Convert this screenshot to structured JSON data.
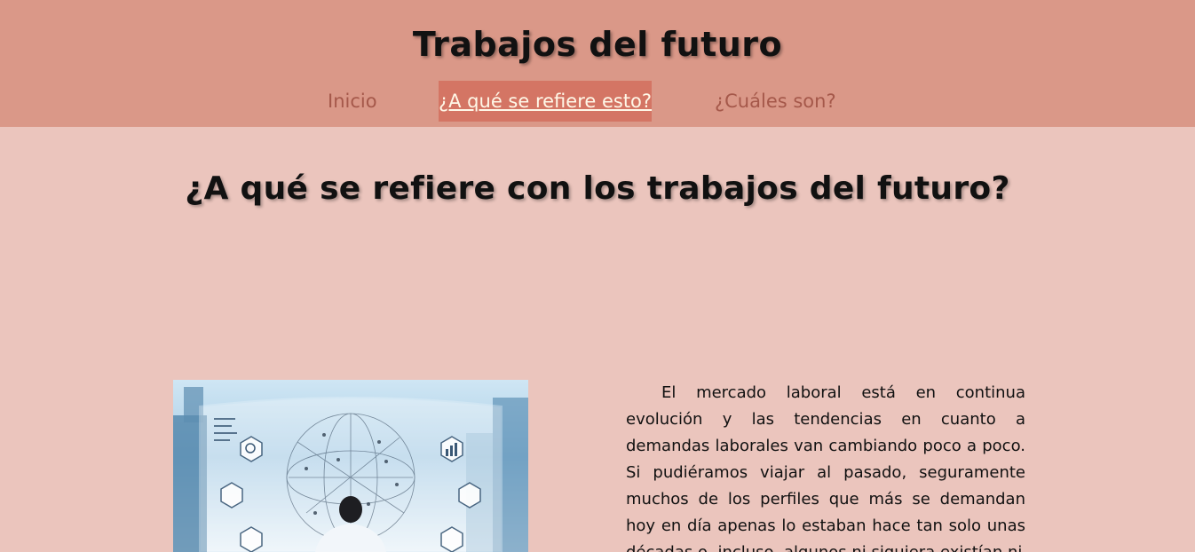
{
  "header": {
    "site_title": "Trabajos del futuro",
    "nav": [
      {
        "label": "Inicio",
        "active": false
      },
      {
        "label": "¿A qué se refiere esto?",
        "active": true
      },
      {
        "label": "¿Cuáles son?",
        "active": false
      }
    ]
  },
  "main": {
    "heading": "¿A qué se refiere con los trabajos del futuro?",
    "paragraph": "El mercado laboral está en continua evolución y las tendencias en cuanto a demandas laborales van cambiando poco a poco. Si pudiéramos viajar al pasado, seguramente muchos de los perfiles que más se demandan hoy en día apenas lo estaban hace tan solo unas décadas o, incluso, algunos ni siquiera existían ni"
  },
  "colors": {
    "header_bg": "#da9888",
    "page_bg": "#ebc5bd",
    "nav_active_bg": "#d47564",
    "nav_link": "#a5584a"
  }
}
